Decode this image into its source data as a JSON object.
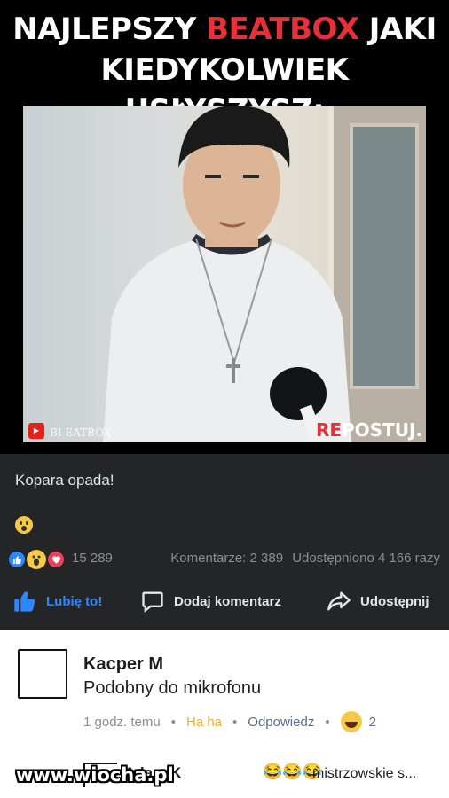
{
  "meme": {
    "headline_part1": "NAJLEPSZY",
    "headline_red": "BEATBOX",
    "headline_part2": "JAKI",
    "headline_line2": "KIEDYKOLWIEK USŁYSZYSZ:"
  },
  "video": {
    "channel_watermark": "BI     EATBOX",
    "yt_label": "You Tube",
    "repost_re": "RE",
    "repost_rest": "POSTUJ."
  },
  "post": {
    "text": "Kopara opada!",
    "emoji_icon": "astonished-face-icon",
    "reaction_count": "15 289",
    "comments": "Komentarze: 2 389",
    "shares": "Udostępniono 4 166 razy"
  },
  "actions": {
    "like": "Lubię to!",
    "comment": "Dodaj komentarz",
    "share": "Udostępnij"
  },
  "comment": {
    "author": "Kacper M",
    "text": "Podobny do mikrofonu",
    "time": "1 godz. temu",
    "haha": "Ha ha",
    "reply": "Odpowiedz",
    "reaction_count": "2"
  },
  "next_comment": {
    "author": "Adam K",
    "emojis": "😂😂😂",
    "preview": "mistrzowskie s..."
  },
  "watermark": "www.wiocha.pl",
  "colors": {
    "fb_dark": "#242526",
    "fb_blue": "#2d88ff",
    "headline_red": "#e8303a",
    "haha_yellow": "#f0b020"
  }
}
